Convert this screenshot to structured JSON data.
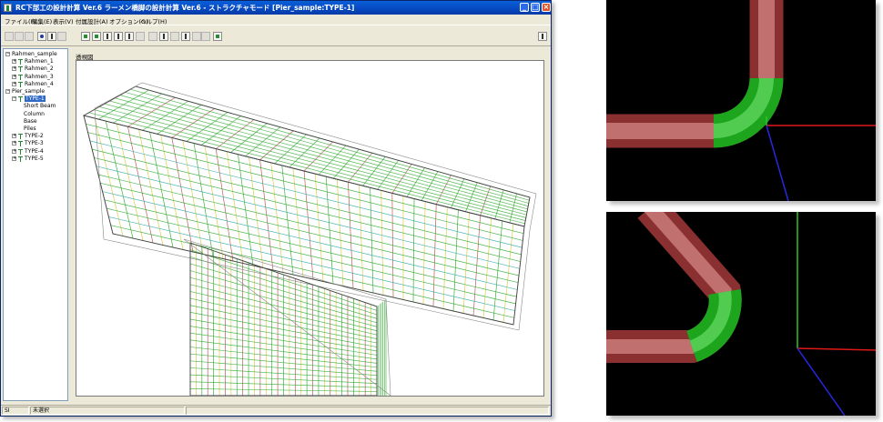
{
  "window": {
    "title": "RC下部工の設計計算 Ver.6 ラーメン橋脚の設計計算 Ver.6 - ストラクチャモード [Pier_sample:TYPE-1]"
  },
  "menu": [
    {
      "label": "ファイル(F)"
    },
    {
      "label": "編集(E)"
    },
    {
      "label": "表示(V)"
    },
    {
      "label": "付属設計(A)"
    },
    {
      "label": "オプション(O)"
    },
    {
      "label": "ヘルプ(H)"
    }
  ],
  "tree": {
    "items": [
      {
        "label": "Rahmen_sample",
        "level": 0,
        "expander": "−"
      },
      {
        "label": "Rahmen_1",
        "level": 1,
        "expander": "+",
        "icon": true
      },
      {
        "label": "Rahmen_2",
        "level": 1,
        "expander": "+",
        "icon": true
      },
      {
        "label": "Rahmen_3",
        "level": 1,
        "expander": "+",
        "icon": true
      },
      {
        "label": "Rahmen_4",
        "level": 1,
        "expander": "+",
        "icon": true
      },
      {
        "label": "Pier_sample",
        "level": 0,
        "expander": "−"
      },
      {
        "label": "TYPE-1",
        "level": 1,
        "expander": "−",
        "icon": true,
        "selected": true
      },
      {
        "label": "Short Beam",
        "level": 2
      },
      {
        "label": "Column",
        "level": 2
      },
      {
        "label": "Base",
        "level": 2
      },
      {
        "label": "Piles",
        "level": 2
      },
      {
        "label": "TYPE-2",
        "level": 1,
        "expander": "+",
        "icon": true
      },
      {
        "label": "TYPE-3",
        "level": 1,
        "expander": "+",
        "icon": true
      },
      {
        "label": "TYPE-4",
        "level": 1,
        "expander": "+",
        "icon": true
      },
      {
        "label": "TYPE-5",
        "level": 1,
        "expander": "+",
        "icon": true
      }
    ]
  },
  "view": {
    "label": "透視図"
  },
  "status": {
    "left": "SI",
    "middle": "未選択"
  },
  "colors": {
    "titlebar": "#0a4fd0",
    "rebar_red": "#b94a4a",
    "rebar_green": "#2aa82a",
    "rebar_yellow": "#d8c83a",
    "rebar_cyan": "#30a8a8",
    "axis_red": "#e01818",
    "axis_green": "#28c828",
    "axis_blue": "#2828e0"
  },
  "icons": [
    "app-icon",
    "minimize-icon",
    "maximize-icon",
    "close-icon",
    "tree-expander-icon",
    "beam-node-icon",
    "restore-view-icon"
  ]
}
